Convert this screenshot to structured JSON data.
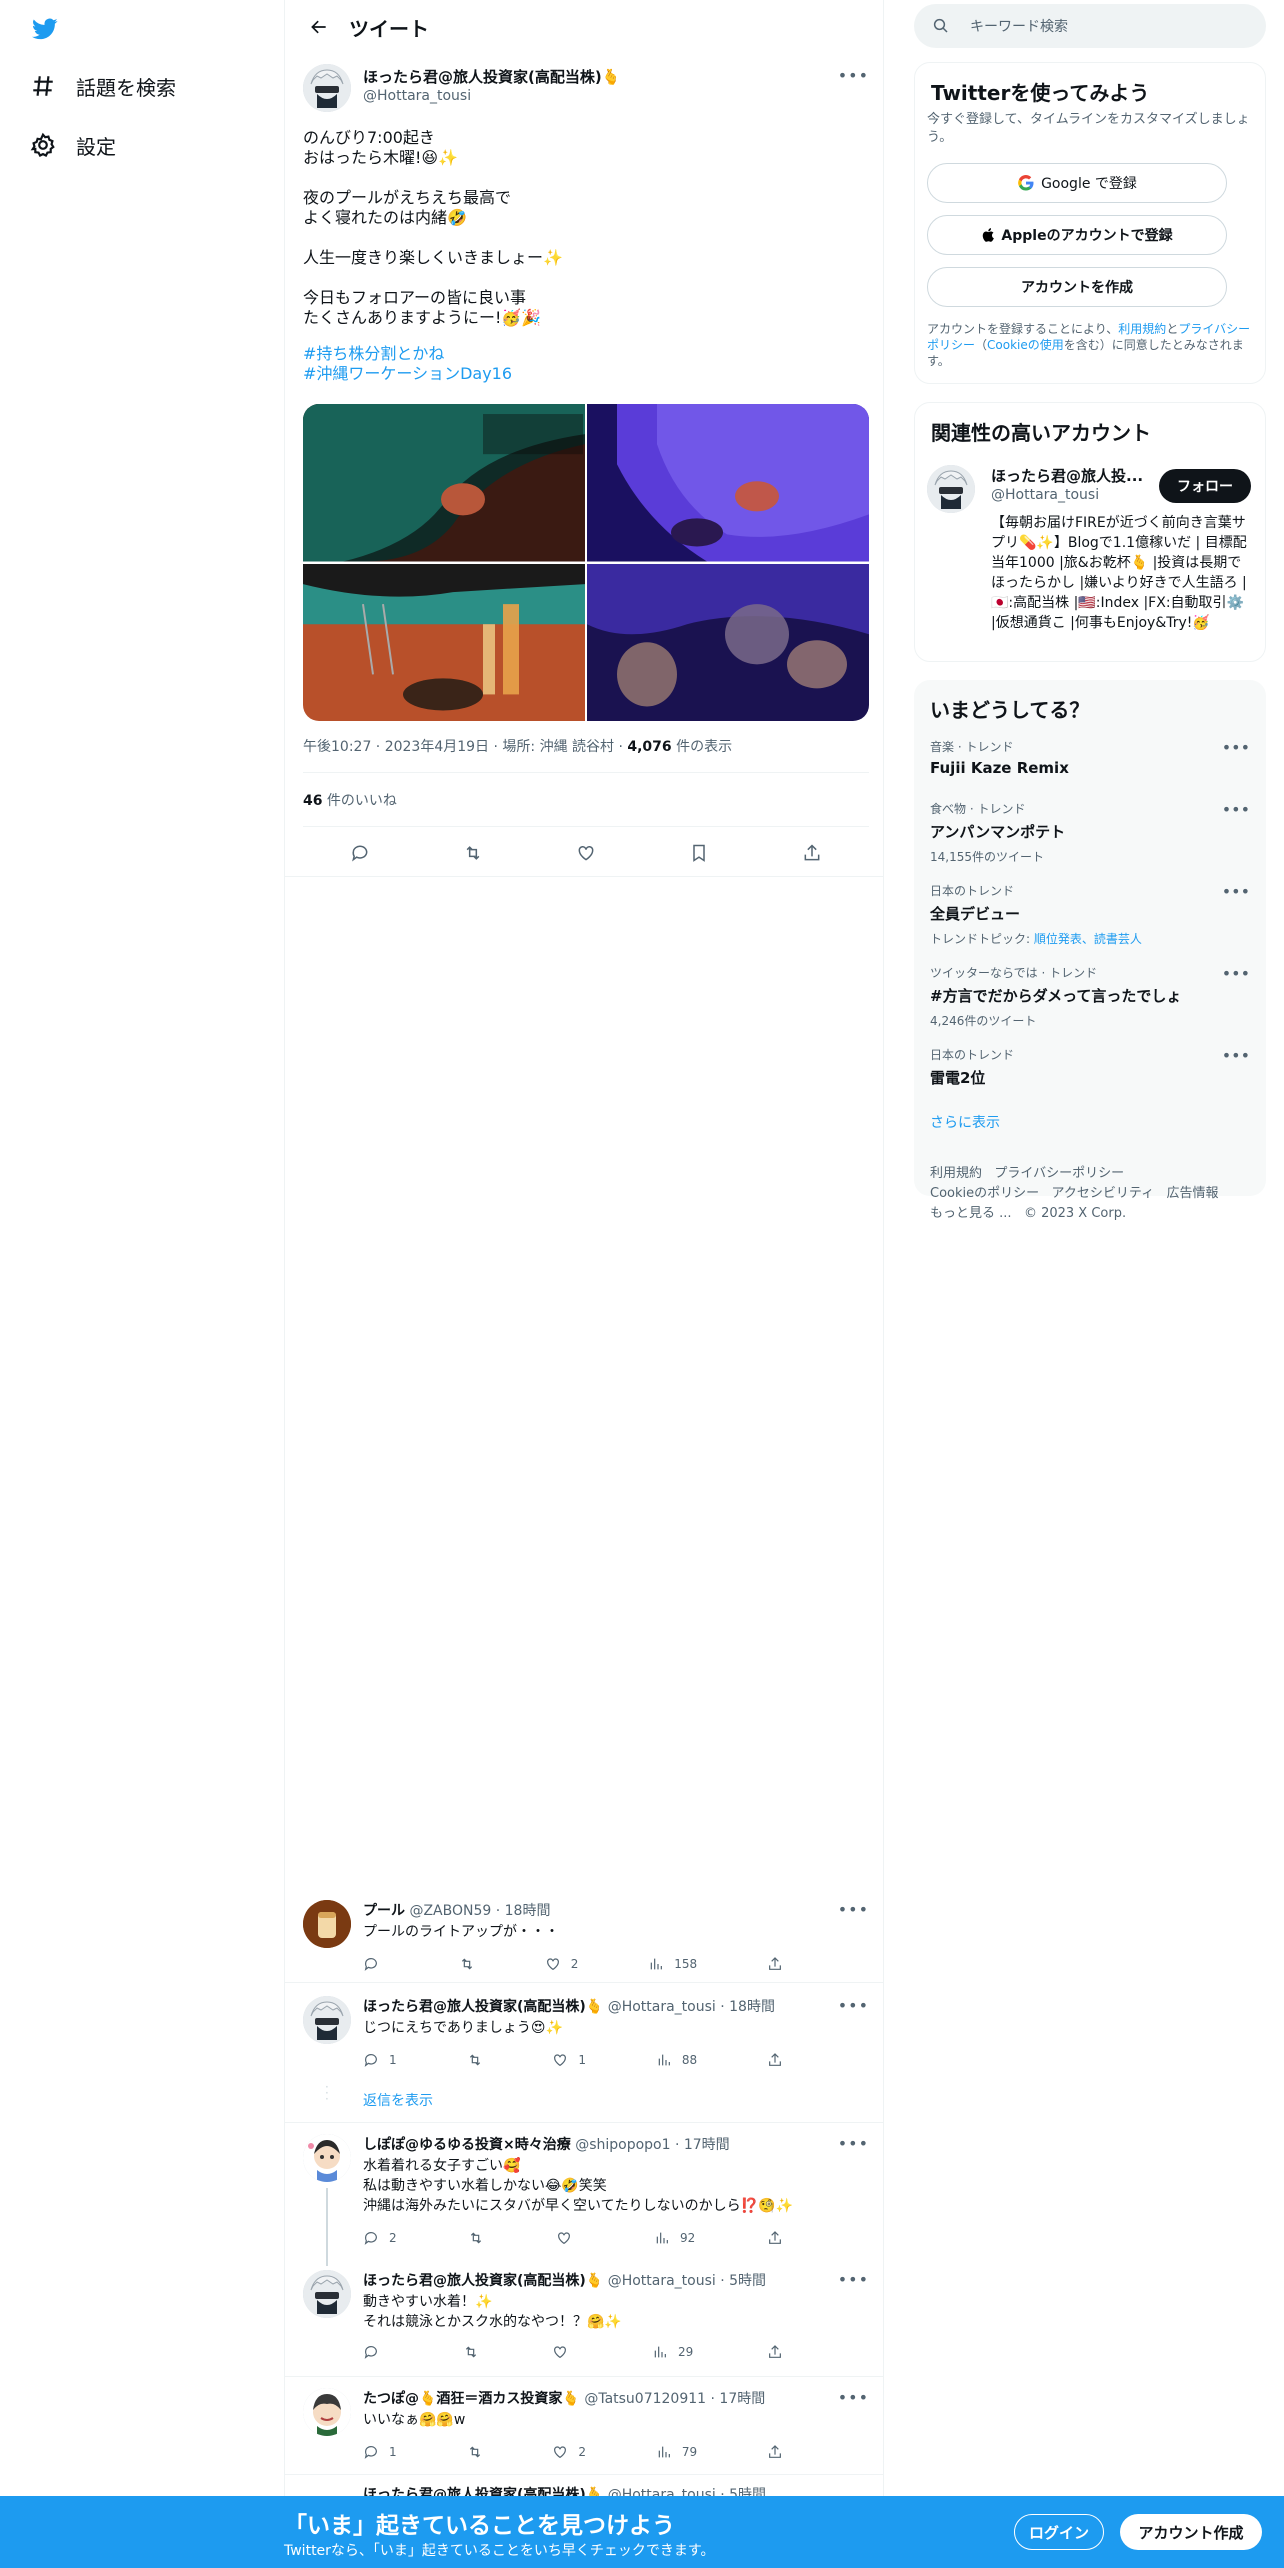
{
  "nav": {
    "explore": "話題を検索",
    "settings": "設定"
  },
  "header": {
    "title": "ツイート"
  },
  "tweet": {
    "author_name": "ほったら君@旅人投資家(高配当株)🫰",
    "author_handle": "@Hottara_tousi",
    "lines": [
      "のんびり7:00起き",
      "おはったら木曜!😆✨",
      "夜のプールがえちえち最高で",
      "よく寝れたのは内緒🤣",
      "人生一度きり楽しくいきましょー✨",
      "今日もフォロアーの皆に良い事",
      "たくさんありますようにー!🥳🎉"
    ],
    "hashtags": [
      "#持ち株分割とかね",
      "#沖縄ワーケーションDay16"
    ],
    "meta_time": "午後10:27 · 2023年4月19日 · 場所: 沖縄 読谷村 · ",
    "views_count": "4,076",
    "views_label": " 件の表示",
    "likes_count": "46",
    "likes_label": " 件のいいね"
  },
  "replies": [
    {
      "name": "プール",
      "handle": "@ZABON59",
      "time": "· 18時間",
      "lines": [
        "プールのライトアップが・・・"
      ],
      "replies": "",
      "likes": "2",
      "views": "158"
    },
    {
      "name": "ほったら君@旅人投資家(高配当株)🫰",
      "handle": "@Hottara_tousi",
      "time": "· 18時間",
      "lines": [
        "じつにえちでありましょう😍✨"
      ],
      "replies": "1",
      "likes": "1",
      "views": "88"
    },
    {
      "name": "しぽぽ@ゆるゆる投資×時々治療",
      "handle": "@shipopopo1",
      "time": "· 17時間",
      "lines": [
        "水着着れる女子すごい🥰",
        "私は動きやすい水着しかない😂🤣笑笑",
        "沖縄は海外みたいにスタバが早く空いてたりしないのかしら⁉️🧐✨"
      ],
      "replies": "2",
      "likes": "",
      "views": "92"
    },
    {
      "name": "ほったら君@旅人投資家(高配当株)🫰",
      "handle": "@Hottara_tousi",
      "time": "· 5時間",
      "lines": [
        "動きやすい水着！✨",
        "それは競泳とかスク水的なやつ！？🤗✨"
      ],
      "replies": "",
      "likes": "",
      "views": "29"
    },
    {
      "name": "たつぽ@🫰酒狂＝酒カス投資家🫰",
      "handle": "@Tatsu07120911",
      "time": "· 17時間",
      "lines": [
        "いいなぁ🤗🤗w"
      ],
      "replies": "1",
      "likes": "2",
      "views": "79"
    },
    {
      "name": "ほったら君@旅人投資家(高配当株)🫰",
      "handle": "@Hottara_tousi",
      "time": "· 5時間",
      "lines": [
        ""
      ],
      "replies": "",
      "likes": "",
      "views": ""
    }
  ],
  "show_replies": "返信を表示",
  "right": {
    "search_placeholder": "キーワード検索",
    "signup_title": "Twitterを使ってみよう",
    "signup_desc": "今すぐ登録して、タイムラインをカスタマイズしましょう。",
    "google_btn": "Google で登録",
    "apple_btn": "Appleのアカウントで登録",
    "create_btn": "アカウントを作成",
    "terms_1": "アカウントを登録することにより、",
    "terms_link1": "利用規約",
    "terms_2": "と",
    "terms_link2": "プライバシーポリシー",
    "terms_3": "（",
    "terms_link3": "Cookieの使用",
    "terms_4": "を含む）に同意したとみなされます。",
    "related_title": "関連性の高いアカウント",
    "related_name": "ほったら君@旅人投...",
    "related_handle": "@Hottara_tousi",
    "follow": "フォロー",
    "related_bio": "【毎朝お届けFIREが近づく前向き言葉サプリ💊✨】Blogで1.1億稼いだ | 目標配当年1000 |旅&お乾杯🫰 |投資は長期でほったらかし |嫌いより好きで人生語ろ | 🇯🇵:高配当株 |🇺🇸:Index |FX:自動取引⚙️ |仮想通貨こ |何事もEnjoy&Try!🥳",
    "trends_title": "いまどうしてる？",
    "trends": [
      {
        "cat": "音楽 · トレンド",
        "name": "Fujii Kaze Remix",
        "sub": ""
      },
      {
        "cat": "食べ物 · トレンド",
        "name": "アンパンマンポテト",
        "sub": "14,155件のツイート"
      },
      {
        "cat": "日本のトレンド",
        "name": "全員デビュー",
        "sub": "トレンドトピック: ",
        "sub_link": "順位発表、読書芸人"
      },
      {
        "cat": "ツイッターならでは · トレンド",
        "name": "#方言でだからダメって言ったでしょ",
        "sub": "4,246件のツイート"
      },
      {
        "cat": "日本のトレンド",
        "name": "雷電2位",
        "sub": ""
      }
    ],
    "show_more": "さらに表示",
    "footer": [
      "利用規約",
      "プライバシーポリシー",
      "Cookieのポリシー",
      "アクセシビリティ",
      "広告情報",
      "もっと見る ...",
      "© 2023 X Corp."
    ]
  },
  "bottom": {
    "title": "「いま」起きていることを見つけよう",
    "sub": "Twitterなら、「いま」起きていることをいち早くチェックできます。",
    "login": "ログイン",
    "signup": "アカウント作成"
  }
}
